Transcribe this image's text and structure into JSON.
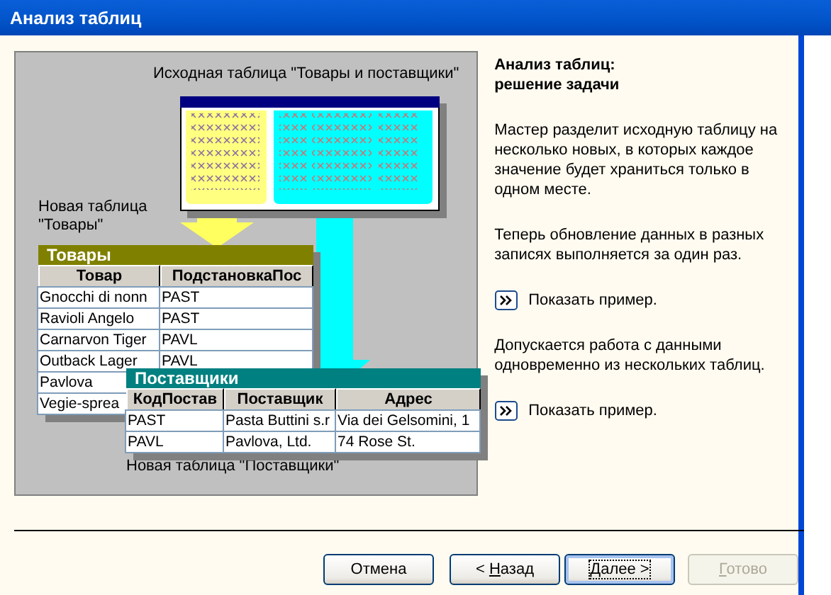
{
  "window": {
    "title": "Анализ таблиц"
  },
  "diagram": {
    "source_caption": "Исходная таблица \"Товары и поставщики\"",
    "new_tables": [
      {
        "caption": "Новая таблица \"Товары\"",
        "title": "Товары",
        "color": "#808000",
        "columns": [
          "Товар",
          "ПодстановкаПос"
        ],
        "rows": [
          [
            "Gnocchi di nonn",
            "PAST"
          ],
          [
            "Ravioli Angelo",
            "PAST"
          ],
          [
            "Carnarvon Tiger",
            "PAVL"
          ],
          [
            "Outback Lager",
            "PAVL"
          ],
          [
            "Pavlova"
          ],
          [
            "Vegie-sprea"
          ]
        ]
      },
      {
        "caption": "Новая таблица \"Поставщики\"",
        "title": "Поставщики",
        "color": "#008080",
        "columns": [
          "КодПостав",
          "Поставщик",
          "Адрес"
        ],
        "rows": [
          [
            "PAST",
            "Pasta Buttini s.r",
            "Via dei Gelsomini, 1"
          ],
          [
            "PAVL",
            "Pavlova, Ltd.",
            "74 Rose St."
          ]
        ]
      }
    ]
  },
  "info": {
    "heading": "Анализ таблиц:\nрешение задачи",
    "blocks": [
      {
        "kind": "text",
        "text": "Мастер разделит исходную таблицу на несколько новых, в которых каждое значение будет храниться только в одном месте."
      },
      {
        "kind": "text",
        "text": "Теперь обновление данных в разных записях выполняется за один раз."
      },
      {
        "kind": "example",
        "text": "Показать пример."
      },
      {
        "kind": "text",
        "text": "Допускается работа с данными одновременно из нескольких таблиц."
      },
      {
        "kind": "example",
        "text": "Показать пример."
      }
    ]
  },
  "buttons": [
    {
      "label": "Отмена",
      "focused": false,
      "disabled": false
    },
    {
      "prefix": "< ",
      "hotkey": "Н",
      "suffix": "азад",
      "focused": false,
      "disabled": false
    },
    {
      "hotkey": "Д",
      "suffix": "алее >",
      "focused": true,
      "disabled": false
    },
    {
      "hotkey": "Г",
      "suffix": "отово",
      "focused": false,
      "disabled": true
    }
  ]
}
